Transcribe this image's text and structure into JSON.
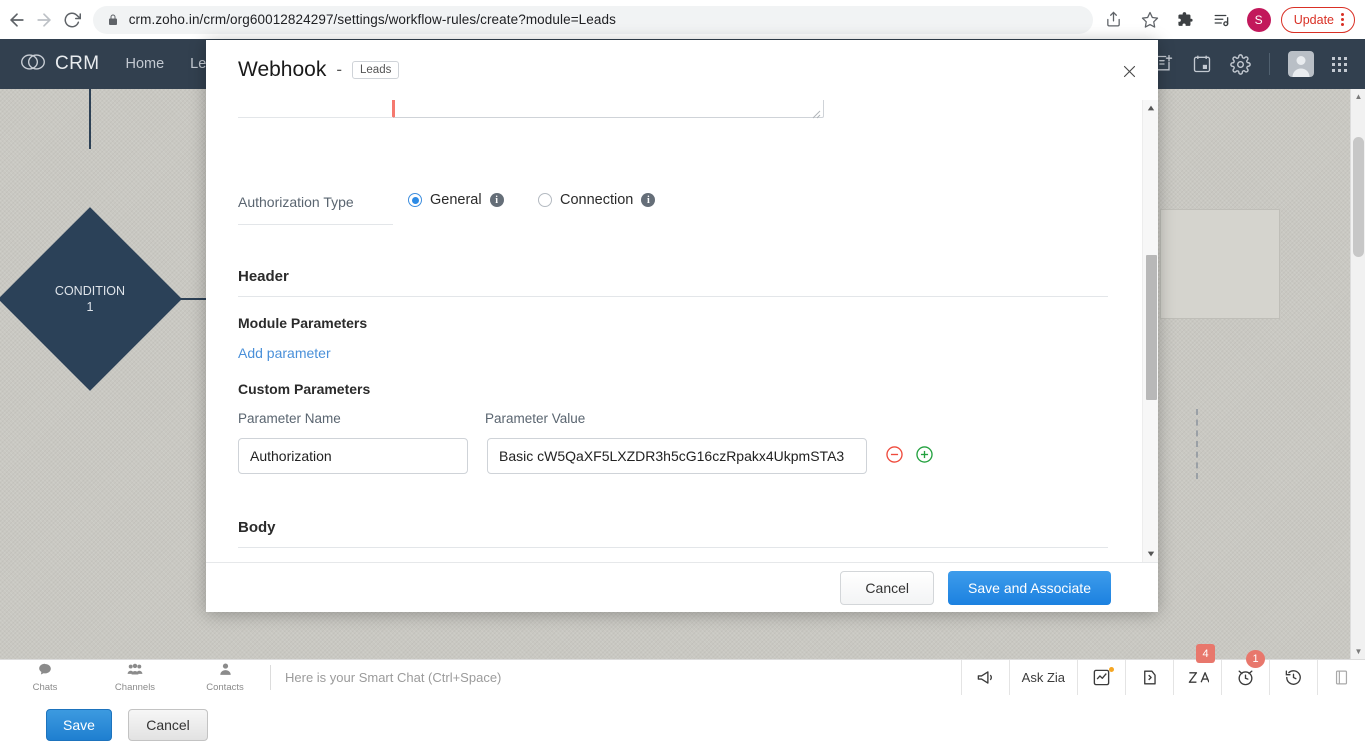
{
  "browser": {
    "back_icon": "back-arrow-icon",
    "forward_icon": "forward-arrow-icon",
    "reload_icon": "reload-icon",
    "lock_icon": "lock-icon",
    "url_host": "crm.zoho.in",
    "url_path": "/crm/org60012824297/settings/workflow-rules/create?module=Leads",
    "url_full": "crm.zoho.in/crm/org60012824297/settings/workflow-rules/create?module=Leads",
    "toolbar_icons": [
      "share-icon",
      "bookmark-star-icon",
      "extensions-puzzle-icon",
      "reading-list-icon"
    ],
    "profile_initial": "S",
    "update_label": "Update"
  },
  "crm_header": {
    "logo_label": "CRM",
    "nav_items": [
      "Home",
      "Lea"
    ],
    "right_icons": [
      "add-note-icon",
      "calendar-icon",
      "settings-gear-icon",
      "user-avatar",
      "apps-grid-icon"
    ]
  },
  "canvas": {
    "condition_node": {
      "line1": "CONDITION",
      "line2": "1"
    },
    "save_label": "Save",
    "cancel_label": "Cancel"
  },
  "modal": {
    "title": "Webhook",
    "title_separator": "-",
    "module_badge": "Leads",
    "close_icon": "close-icon",
    "auth": {
      "label": "Authorization Type",
      "options": [
        {
          "label": "General",
          "selected": true,
          "info_icon": "info-icon"
        },
        {
          "label": "Connection",
          "selected": false,
          "info_icon": "info-icon"
        }
      ]
    },
    "header_section": {
      "title": "Header",
      "module_parameters_title": "Module Parameters",
      "add_parameter_link": "Add parameter",
      "custom_parameters_title": "Custom Parameters",
      "param_name_label": "Parameter Name",
      "param_value_label": "Parameter Value",
      "rows": [
        {
          "name": "Authorization",
          "value": "Basic cW5QaXF5LXZDR3h5cG16czRpakx4UkpmSTA3",
          "remove_icon": "minus-circle-icon",
          "add_icon": "plus-circle-icon"
        }
      ]
    },
    "body_section": {
      "title": "Body"
    },
    "footer": {
      "cancel_label": "Cancel",
      "save_label": "Save and Associate"
    }
  },
  "bottom_bar": {
    "left_items": [
      {
        "label": "Chats",
        "icon": "chat-bubble-icon"
      },
      {
        "label": "Channels",
        "icon": "channels-group-icon"
      },
      {
        "label": "Contacts",
        "icon": "contact-person-icon"
      }
    ],
    "smart_chat_placeholder": "Here is your Smart Chat (Ctrl+Space)",
    "right_items": [
      {
        "label": "",
        "icon": "megaphone-icon",
        "badge": ""
      },
      {
        "label": "Ask Zia",
        "icon": "",
        "badge": ""
      },
      {
        "label": "",
        "icon": "analytics-box-icon",
        "badge": ""
      },
      {
        "label": "",
        "icon": "share-arrow-icon",
        "badge": ""
      },
      {
        "label": "",
        "icon": "zia-icon",
        "badge": "4"
      },
      {
        "label": "",
        "icon": "alarm-clock-icon",
        "badge": "1"
      },
      {
        "label": "",
        "icon": "history-clock-icon",
        "badge": ""
      },
      {
        "label": "",
        "icon": "notes-icon",
        "badge": ""
      }
    ]
  },
  "colors": {
    "crm_header_bg": "#32404f",
    "primary_blue": "#1c81e0",
    "link_blue": "#4a90d9",
    "required_red": "#f5796f",
    "badge_red": "#e8776c",
    "node_navy": "#2b4158"
  }
}
